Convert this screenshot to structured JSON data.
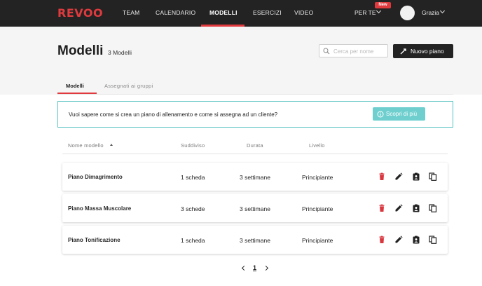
{
  "app": {
    "logo": "REVOO"
  },
  "nav": {
    "items": [
      {
        "label": "TEAM"
      },
      {
        "label": "CALENDARIO"
      },
      {
        "label": "MODELLI"
      },
      {
        "label": "ESERCIZI"
      },
      {
        "label": "VIDEO"
      }
    ],
    "active": "MODELLI",
    "per_te": "PER TE",
    "new_badge": "New",
    "user_name": "Grazia"
  },
  "header": {
    "title": "Modelli",
    "count": "3 Modelli",
    "search_placeholder": "Cerca per nome",
    "new_plan_label": "Nuovo piano"
  },
  "tabs": [
    {
      "label": "Modelli",
      "active": true
    },
    {
      "label": "Assegnati ai gruppi",
      "active": false
    }
  ],
  "banner": {
    "text": "Vuoi sapere come si crea un piano di allenamento e come si assegna ad un cliente?",
    "button_label": "Scopri di più"
  },
  "table": {
    "columns": [
      "Nome modello",
      "Suddiviso",
      "Durata",
      "Livello"
    ],
    "rows": [
      {
        "name": "Piano Dimagrimento",
        "split": "1 scheda",
        "duration": "3 settimane",
        "level": "Principiante"
      },
      {
        "name": "Piano Massa Muscolare",
        "split": "3 schede",
        "duration": "3 settimane",
        "level": "Principiante"
      },
      {
        "name": "Piano Tonificazione",
        "split": "1 scheda",
        "duration": "3 settimane",
        "level": "Principiante"
      }
    ],
    "row_actions": [
      "delete-icon",
      "edit-icon",
      "assign-clipboard-icon",
      "copy-icon"
    ]
  },
  "pagination": {
    "current": "1"
  },
  "colors": {
    "brand_red": "#e03a3e",
    "nav_bg": "#232323",
    "teal": "#5ac3c3",
    "delete_red": "#d9363e"
  }
}
